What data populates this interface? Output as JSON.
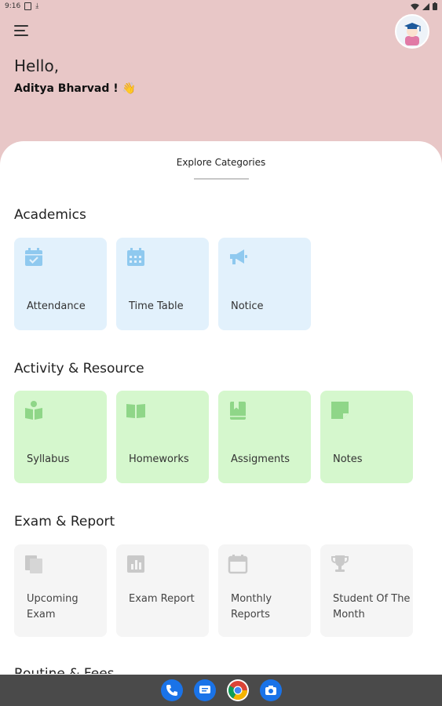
{
  "status_bar": {
    "time": "9:16"
  },
  "header": {
    "greeting": "Hello,",
    "user_name": "Aditya Bharvad ! 👋"
  },
  "sheet": {
    "title": "Explore Categories"
  },
  "sections": {
    "academics": {
      "title": "Academics",
      "items": [
        {
          "label": "Attendance",
          "icon": "calendar-check-icon"
        },
        {
          "label": "Time Table",
          "icon": "calendar-grid-icon"
        },
        {
          "label": "Notice",
          "icon": "megaphone-icon"
        }
      ],
      "color": "#e2f1fc",
      "icon_color": "#8fc9ef"
    },
    "activity": {
      "title": "Activity & Resource",
      "items": [
        {
          "label": "Syllabus",
          "icon": "reader-icon"
        },
        {
          "label": "Homeworks",
          "icon": "open-book-icon"
        },
        {
          "label": "Assigments",
          "icon": "bookmark-book-icon"
        },
        {
          "label": "Notes",
          "icon": "sticky-note-icon"
        }
      ],
      "color": "#d5f7cd",
      "icon_color": "#8fd688"
    },
    "exam": {
      "title": "Exam & Report",
      "items": [
        {
          "label": "Upcoming Exam",
          "icon": "documents-icon"
        },
        {
          "label": "Exam Report",
          "icon": "bar-chart-icon"
        },
        {
          "label": "Monthly Reports",
          "icon": "calendar-icon"
        },
        {
          "label": "Student Of The Month",
          "icon": "trophy-icon"
        }
      ],
      "color": "#f5f5f5",
      "icon_color": "#c9c9c9"
    },
    "next": {
      "title": "Routine & Fees"
    }
  },
  "dock": {
    "apps": [
      {
        "name": "phone-app-icon",
        "color": "#1a73e8"
      },
      {
        "name": "messages-app-icon",
        "color": "#1a73e8"
      },
      {
        "name": "chrome-app-icon",
        "color": "#ffffff"
      },
      {
        "name": "camera-app-icon",
        "color": "#1a73e8"
      }
    ]
  }
}
